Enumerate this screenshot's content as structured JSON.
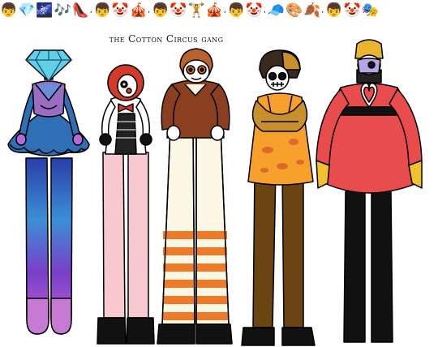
{
  "title": "the Cotton Circus gang",
  "emoji_bar": {
    "items": [
      {
        "glyph": "👦",
        "sep": ""
      },
      {
        "glyph": "💎",
        "sep": ""
      },
      {
        "glyph": "🌌",
        "sep": ""
      },
      {
        "glyph": "🎶",
        "sep": ""
      },
      {
        "glyph": "👠",
        "sep": ","
      },
      {
        "glyph": "👦",
        "sep": ""
      },
      {
        "glyph": "🤡",
        "sep": ""
      },
      {
        "glyph": "🎪",
        "sep": ","
      },
      {
        "glyph": "👦",
        "sep": ""
      },
      {
        "glyph": "🤡",
        "sep": ""
      },
      {
        "glyph": "🏋",
        "sep": ""
      },
      {
        "glyph": "🎪",
        "sep": ","
      },
      {
        "glyph": "👦",
        "sep": ""
      },
      {
        "glyph": "🤡",
        "sep": ","
      },
      {
        "glyph": "🧢",
        "sep": ""
      },
      {
        "glyph": "🎨",
        "sep": ""
      },
      {
        "glyph": "🍂",
        "sep": ","
      },
      {
        "glyph": "👦",
        "sep": ""
      },
      {
        "glyph": "🤡",
        "sep": ""
      },
      {
        "glyph": "🎭",
        "sep": ""
      },
      {
        "glyph": "👗",
        "sep": ""
      },
      {
        "glyph": "🎯",
        "sep": ""
      },
      {
        "glyph": "💄",
        "sep": ""
      }
    ]
  },
  "characters": [
    {
      "name": "diamond-clown",
      "colors": {
        "dress": "#2f6fb5",
        "top": "#9b6cc4",
        "diamond": "#5fd0e8",
        "legs_top": "#3b8fd6",
        "legs_bottom": "#b56ad8"
      }
    },
    {
      "name": "red-hair-clown",
      "colors": {
        "hair": "#d33a2a",
        "legs": "#f7c8cf",
        "vest": "#222222"
      }
    },
    {
      "name": "striped-stilts-clown",
      "colors": {
        "shirt": "#8a4020",
        "hair": "#b9622b",
        "pants": "#fbf7e4",
        "stripe": "#f07a28"
      }
    },
    {
      "name": "autumn-clown",
      "colors": {
        "hat": "#3a2a1e",
        "hair": "#c8902a",
        "smock": "#f7a02b",
        "legs": "#6b4412"
      }
    },
    {
      "name": "heart-dress-clown",
      "colors": {
        "dress": "#e94c4c",
        "hat": "#e9b430",
        "legs": "#111111",
        "gloves": "#efc22e"
      }
    }
  ]
}
